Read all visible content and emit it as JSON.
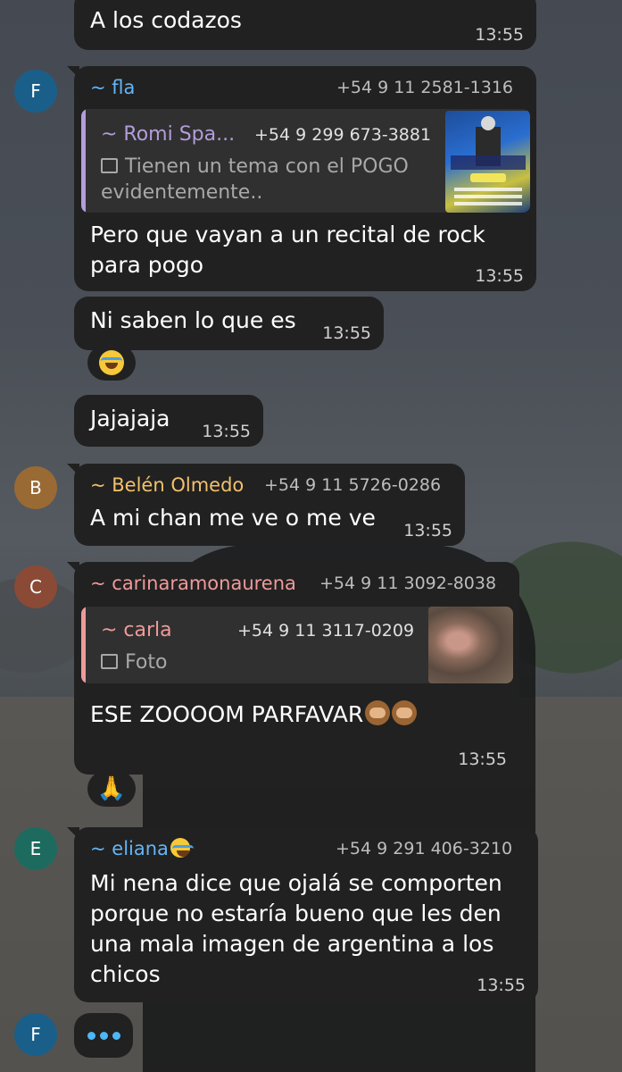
{
  "colors": {
    "bubble": "#212121",
    "quote_bg": "#303030",
    "sender_fla": "#64b5f6",
    "sender_belen": "#f2c16b",
    "sender_carina": "#ef9a9a",
    "sender_eliana": "#64b5f6",
    "quote_romi": "#b39ddb",
    "quote_carla": "#ef9a9a",
    "avatar_f": "#1a5f8a",
    "avatar_b": "#9a6a35",
    "avatar_c": "#8a4a35",
    "avatar_e": "#1d6b5f"
  },
  "messages": [
    {
      "text": "A los codazos",
      "time": "13:55"
    },
    {
      "avatar": "F",
      "sender": "~ fla",
      "phone": "+54 9 11 2581-1316",
      "reply": {
        "name": "~ Romi Spa...",
        "phone": "+54 9 299 673-3881",
        "text": "Tienen un tema con el POGO evidentemente..",
        "thumb": "image-thumbnail"
      },
      "text_lines": [
        "Pero que vayan a un recital de rock",
        "para pogo"
      ],
      "time": "13:55"
    },
    {
      "text": "Ni saben lo que es",
      "time": "13:55",
      "reaction": "laughing-tears-emoji"
    },
    {
      "text": "Jajajaja",
      "time": "13:55"
    },
    {
      "avatar": "B",
      "sender": "~ Belén Olmedo",
      "phone": "+54 9 11 5726-0286",
      "text": "A mi chan me ve o me ve",
      "time": "13:55"
    },
    {
      "avatar": "C",
      "sender": "~ carinaramonaurena",
      "phone": "+54 9 11 3092-8038",
      "reply": {
        "name": "~ carla",
        "phone": "+54 9 11 3117-0209",
        "text": "Foto",
        "thumb": "photo-thumbnail"
      },
      "text": "ESE  ZOOOOM  PARFAVAR",
      "time": "13:55",
      "reaction": "folded-hands-emoji"
    },
    {
      "avatar": "E",
      "sender": "~ eliana",
      "phone": "+54 9 291 406-3210",
      "text_lines": [
        "Mi nena dice que ojalá se comporten",
        "porque no estaría bueno que les den",
        "una mala imagen de argentina a los",
        "chicos"
      ],
      "time": "13:55"
    },
    {
      "avatar": "F",
      "typing": "typing-indicator"
    }
  ]
}
